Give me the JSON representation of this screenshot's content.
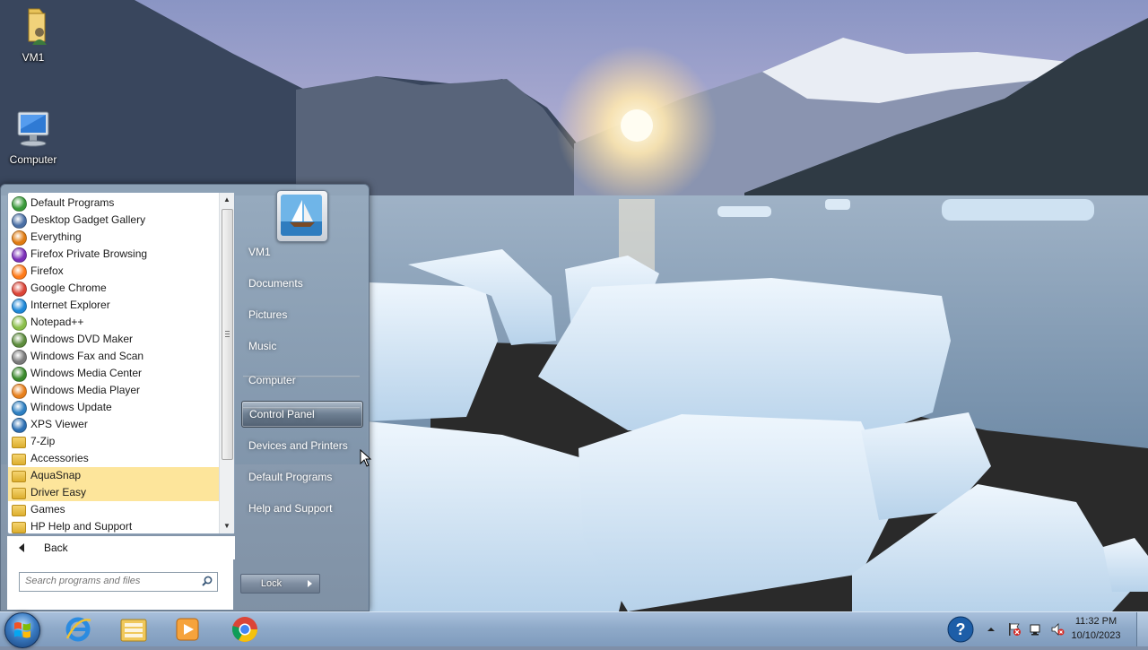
{
  "desktop": {
    "icons": [
      {
        "label": "VM1",
        "icon": "user-folder-icon"
      },
      {
        "label": "Computer",
        "icon": "computer-icon"
      }
    ]
  },
  "start_menu": {
    "programs": [
      {
        "label": "Default Programs",
        "icon": "default-programs-icon",
        "color": "#3a9a3a"
      },
      {
        "label": "Desktop Gadget Gallery",
        "icon": "gadget-icon",
        "color": "#4a6fa5"
      },
      {
        "label": "Everything",
        "icon": "magnifier-icon",
        "color": "#e07b10"
      },
      {
        "label": "Firefox Private Browsing",
        "icon": "firefox-private-icon",
        "color": "#7b2fb8"
      },
      {
        "label": "Firefox",
        "icon": "firefox-icon",
        "color": "#ff7a18"
      },
      {
        "label": "Google Chrome",
        "icon": "chrome-icon",
        "color": "#db4437"
      },
      {
        "label": "Internet Explorer",
        "icon": "ie-icon",
        "color": "#1e88d8"
      },
      {
        "label": "Notepad++",
        "icon": "notepad-icon",
        "color": "#8bbf4a"
      },
      {
        "label": "Windows DVD Maker",
        "icon": "dvd-maker-icon",
        "color": "#5c8c3c"
      },
      {
        "label": "Windows Fax and Scan",
        "icon": "fax-icon",
        "color": "#7a7a7a"
      },
      {
        "label": "Windows Media Center",
        "icon": "media-center-icon",
        "color": "#3b8a2c"
      },
      {
        "label": "Windows Media Player",
        "icon": "media-player-icon",
        "color": "#e8801c"
      },
      {
        "label": "Windows Update",
        "icon": "windows-update-icon",
        "color": "#2d7fc2"
      },
      {
        "label": "XPS Viewer",
        "icon": "xps-icon",
        "color": "#2c6fb3"
      },
      {
        "label": "7-Zip",
        "icon": "folder-icon",
        "color": "#e0b43a"
      },
      {
        "label": "Accessories",
        "icon": "folder-icon",
        "color": "#e0b43a"
      },
      {
        "label": "AquaSnap",
        "icon": "folder-icon",
        "color": "#e0b43a",
        "highlight": true
      },
      {
        "label": "Driver Easy",
        "icon": "folder-icon",
        "color": "#e0b43a",
        "highlight": true
      },
      {
        "label": "Games",
        "icon": "folder-icon",
        "color": "#e0b43a"
      },
      {
        "label": "HP Help and Support",
        "icon": "folder-icon",
        "color": "#e0b43a"
      }
    ],
    "back_label": "Back",
    "search_placeholder": "Search programs and files",
    "right_items": [
      {
        "label": "VM1"
      },
      {
        "label": "Documents"
      },
      {
        "label": "Pictures"
      },
      {
        "label": "Music"
      },
      {
        "label": "Computer"
      },
      {
        "label": "Control Panel",
        "selected": true
      },
      {
        "label": "Devices and Printers"
      },
      {
        "label": "Default Programs"
      },
      {
        "label": "Help and Support"
      }
    ],
    "lock_label": "Lock"
  },
  "taskbar": {
    "pinned": [
      {
        "name": "internet-explorer",
        "icon": "ie-icon"
      },
      {
        "name": "file-explorer",
        "icon": "explorer-folder-icon"
      },
      {
        "name": "media-player",
        "icon": "media-player-icon"
      },
      {
        "name": "chrome",
        "icon": "chrome-icon"
      }
    ],
    "tray": {
      "time": "11:32 PM",
      "date": "10/10/2023"
    }
  }
}
